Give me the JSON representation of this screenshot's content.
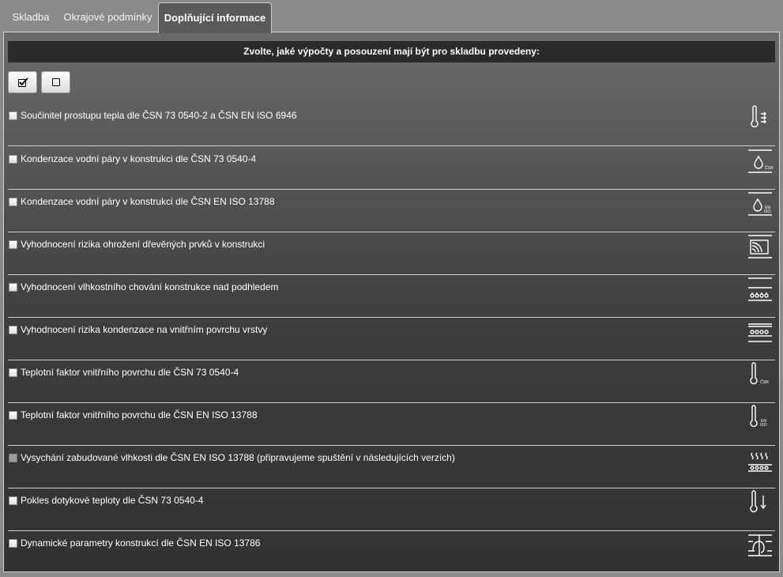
{
  "tabs": [
    {
      "label": "Skladba",
      "active": false
    },
    {
      "label": "Okrajové podmínky",
      "active": false
    },
    {
      "label": "Doplňující informace",
      "active": true
    }
  ],
  "header": {
    "text": "Zvolte, jaké výpočty a posouzení mají být pro skladbu provedeny:"
  },
  "toolbar": {
    "check_all_icon": "checkbox-checked-icon",
    "uncheck_all_icon": "checkbox-empty-icon"
  },
  "options": [
    {
      "label": "Součinitel prostupu tepla dle ČSN 73 0540-2 a ČSN EN ISO 6946",
      "icon": "thermometer-heat-flow-icon",
      "checked": false,
      "enabled": true
    },
    {
      "label": "Kondenzace vodní páry v konstrukci dle ČSN 73 0540-4",
      "icon": "drop-csn-icon",
      "icon_text": "ČSN",
      "checked": false,
      "enabled": true
    },
    {
      "label": "Kondenzace vodní páry v konstrukci dle ČSN EN ISO 13788",
      "icon": "drop-en-iso-icon",
      "icon_text": [
        "EN",
        "ISO"
      ],
      "checked": false,
      "enabled": true
    },
    {
      "label": "Vyhodnocení rizika ohrožení dřevěných prvků v konstrukci",
      "icon": "timber-element-icon",
      "checked": false,
      "enabled": true
    },
    {
      "label": "Vyhodnocení vlhkostního chování konstrukce nad podhledem",
      "icon": "moisture-under-ceiling-icon",
      "checked": false,
      "enabled": true
    },
    {
      "label": "Vyhodnocení rizika kondenzace na vnitřním povrchu vrstvy",
      "icon": "surface-condensation-icon",
      "checked": false,
      "enabled": true
    },
    {
      "label": "Teplotní faktor vnitřního povrchu dle ČSN 73 0540-4",
      "icon": "thermometer-csn-icon",
      "icon_text": "ČSN",
      "checked": false,
      "enabled": true
    },
    {
      "label": "Teplotní faktor vnitřního povrchu dle ČSN EN ISO 13788",
      "icon": "thermometer-en-iso-icon",
      "icon_text": [
        "EN",
        "ISO"
      ],
      "checked": false,
      "enabled": true
    },
    {
      "label": "Vysychání zabudované vlhkosti dle ČSN EN ISO 13788 (připravujeme spuštění v následujících verzích)",
      "icon": "drying-moisture-icon",
      "checked": false,
      "enabled": false
    },
    {
      "label": "Pokles dotykové teploty dle ČSN 73 0540-4",
      "icon": "thermometer-drop-icon",
      "checked": false,
      "enabled": true
    },
    {
      "label": "Dynamické parametry konstrukcí dle ČSN EN ISO 13786",
      "icon": "dynamic-wave-icon",
      "checked": false,
      "enabled": true
    }
  ]
}
